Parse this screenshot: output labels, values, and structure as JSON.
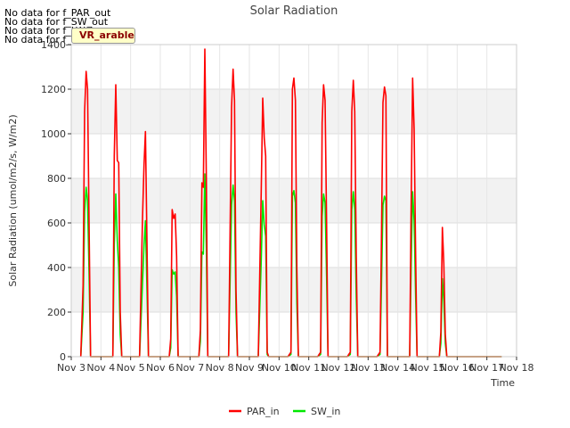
{
  "no_data_messages": [
    "No data for f_PAR_out",
    "No data for f_SW_out",
    "No data for f_LW_in",
    "No data for f_LW_out"
  ],
  "badge": "VR_arable",
  "chart_data": {
    "type": "line",
    "title": "Solar Radiation",
    "xlabel": "Time",
    "ylabel": "Solar Radiation (umol/m2/s, W/m2)",
    "xlim": [
      3,
      18
    ],
    "ylim": [
      0,
      1400
    ],
    "x_ticks": [
      {
        "value": 3,
        "label": "Nov 3"
      },
      {
        "value": 4,
        "label": "Nov 4"
      },
      {
        "value": 5,
        "label": "Nov 5"
      },
      {
        "value": 6,
        "label": "Nov 6"
      },
      {
        "value": 7,
        "label": "Nov 7"
      },
      {
        "value": 8,
        "label": "Nov 8"
      },
      {
        "value": 9,
        "label": "Nov 9"
      },
      {
        "value": 10,
        "label": "Nov 10"
      },
      {
        "value": 11,
        "label": "Nov 11"
      },
      {
        "value": 12,
        "label": "Nov 12"
      },
      {
        "value": 13,
        "label": "Nov 13"
      },
      {
        "value": 14,
        "label": "Nov 14"
      },
      {
        "value": 15,
        "label": "Nov 15"
      },
      {
        "value": 16,
        "label": "Nov 16"
      },
      {
        "value": 17,
        "label": "Nov 17"
      },
      {
        "value": 18,
        "label": "Nov 18"
      }
    ],
    "y_ticks": [
      0,
      200,
      400,
      600,
      800,
      1000,
      1200,
      1400
    ],
    "grid": "horizontal bands",
    "legend_position": "bottom-center",
    "series": [
      {
        "name": "PAR_in",
        "color": "#ff0000",
        "x": [
          3.32,
          3.4,
          3.45,
          3.5,
          3.55,
          3.6,
          3.65,
          3.7,
          3.75,
          3.82,
          3.9,
          4.4,
          4.45,
          4.5,
          4.55,
          4.6,
          4.65,
          4.7,
          4.75,
          4.8,
          4.9,
          5.3,
          5.4,
          5.45,
          5.5,
          5.55,
          5.6,
          5.65,
          5.7,
          5.8,
          6.3,
          6.35,
          6.4,
          6.45,
          6.5,
          6.55,
          6.6,
          6.7,
          6.8,
          7.3,
          7.35,
          7.4,
          7.45,
          7.5,
          7.55,
          7.6,
          7.65,
          7.7,
          7.8,
          8.3,
          8.4,
          8.45,
          8.5,
          8.55,
          8.6,
          8.65,
          8.7,
          8.8,
          9.3,
          9.4,
          9.45,
          9.5,
          9.55,
          9.6,
          9.65,
          9.7,
          9.8,
          10.3,
          10.4,
          10.45,
          10.5,
          10.55,
          10.6,
          10.65,
          10.7,
          10.8,
          11.3,
          11.4,
          11.45,
          11.5,
          11.55,
          11.6,
          11.65,
          11.7,
          11.8,
          12.3,
          12.4,
          12.45,
          12.5,
          12.55,
          12.6,
          12.65,
          12.7,
          12.8,
          13.3,
          13.4,
          13.45,
          13.5,
          13.55,
          13.6,
          13.65,
          13.7,
          13.8,
          14.3,
          14.4,
          14.45,
          14.5,
          14.55,
          14.6,
          14.65,
          14.7,
          14.8,
          15.3,
          15.4,
          15.45,
          15.5,
          15.55,
          15.6,
          15.65,
          15.7,
          15.8,
          17.5
        ],
        "y": [
          0,
          320,
          1100,
          1280,
          1200,
          600,
          0,
          0,
          0,
          0,
          0,
          0,
          900,
          1220,
          880,
          870,
          200,
          0,
          0,
          0,
          0,
          0,
          620,
          860,
          1010,
          520,
          0,
          0,
          0,
          0,
          0,
          80,
          660,
          620,
          640,
          450,
          0,
          0,
          0,
          0,
          120,
          780,
          760,
          1380,
          790,
          0,
          0,
          0,
          0,
          0,
          1120,
          1290,
          1150,
          300,
          0,
          0,
          0,
          0,
          0,
          740,
          1160,
          980,
          900,
          20,
          0,
          0,
          0,
          0,
          20,
          1200,
          1250,
          1150,
          400,
          0,
          0,
          0,
          0,
          20,
          1050,
          1220,
          1150,
          600,
          0,
          0,
          0,
          0,
          20,
          1100,
          1240,
          1100,
          450,
          0,
          0,
          0,
          0,
          20,
          530,
          1140,
          1210,
          1170,
          0,
          0,
          0,
          0,
          0,
          700,
          1250,
          1020,
          450,
          0,
          0,
          0,
          0,
          0,
          110,
          580,
          420,
          100,
          0,
          0,
          0,
          0
        ]
      },
      {
        "name": "SW_in",
        "color": "#00e800",
        "x": [
          3.32,
          3.4,
          3.45,
          3.5,
          3.55,
          3.6,
          3.65,
          3.7,
          3.75,
          3.82,
          3.9,
          4.4,
          4.45,
          4.5,
          4.55,
          4.6,
          4.65,
          4.7,
          4.75,
          4.8,
          4.9,
          5.3,
          5.4,
          5.45,
          5.5,
          5.55,
          5.6,
          5.65,
          5.7,
          5.8,
          6.3,
          6.35,
          6.4,
          6.45,
          6.5,
          6.55,
          6.6,
          6.7,
          6.8,
          7.3,
          7.35,
          7.4,
          7.45,
          7.5,
          7.55,
          7.6,
          7.65,
          7.7,
          7.8,
          8.3,
          8.4,
          8.45,
          8.5,
          8.55,
          8.6,
          8.65,
          8.7,
          8.8,
          9.3,
          9.4,
          9.45,
          9.5,
          9.55,
          9.6,
          9.65,
          9.7,
          9.8,
          10.3,
          10.4,
          10.45,
          10.5,
          10.55,
          10.6,
          10.65,
          10.7,
          10.8,
          11.3,
          11.4,
          11.45,
          11.5,
          11.55,
          11.6,
          11.65,
          11.7,
          11.8,
          12.3,
          12.4,
          12.45,
          12.5,
          12.55,
          12.6,
          12.65,
          12.7,
          12.8,
          13.3,
          13.4,
          13.45,
          13.5,
          13.55,
          13.6,
          13.65,
          13.7,
          13.8,
          14.3,
          14.4,
          14.45,
          14.5,
          14.55,
          14.6,
          14.65,
          14.7,
          14.8,
          15.3,
          15.4,
          15.45,
          15.5,
          15.55,
          15.6,
          15.65,
          15.7,
          15.8,
          17.5
        ],
        "y": [
          0,
          200,
          650,
          760,
          700,
          380,
          0,
          0,
          0,
          0,
          0,
          0,
          500,
          730,
          520,
          400,
          100,
          0,
          0,
          0,
          0,
          0,
          330,
          500,
          610,
          310,
          0,
          0,
          0,
          0,
          0,
          40,
          390,
          370,
          380,
          270,
          0,
          0,
          0,
          0,
          70,
          470,
          460,
          820,
          480,
          0,
          0,
          0,
          0,
          0,
          680,
          770,
          700,
          200,
          0,
          0,
          0,
          0,
          0,
          430,
          700,
          590,
          540,
          10,
          0,
          0,
          0,
          0,
          10,
          720,
          745,
          690,
          240,
          0,
          0,
          0,
          0,
          10,
          630,
          730,
          690,
          360,
          0,
          0,
          0,
          0,
          10,
          660,
          740,
          660,
          270,
          0,
          0,
          0,
          0,
          10,
          320,
          680,
          720,
          700,
          0,
          0,
          0,
          0,
          0,
          420,
          740,
          610,
          270,
          0,
          0,
          0,
          0,
          0,
          60,
          350,
          250,
          60,
          0,
          0,
          0,
          0
        ]
      }
    ]
  }
}
